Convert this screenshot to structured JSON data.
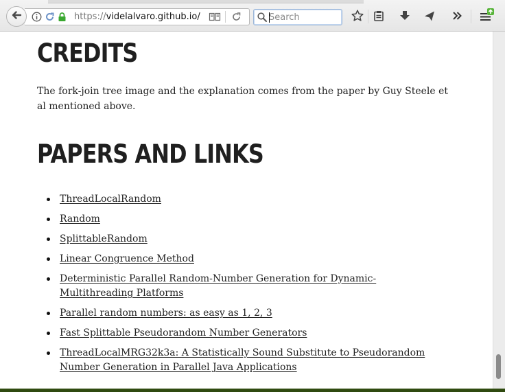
{
  "browser": {
    "url_scheme": "https://",
    "url_host": "videlalvaro.github.io/",
    "search_placeholder": "Search"
  },
  "page": {
    "credits_heading": "CREDITS",
    "credits_text": "The fork-join tree image and the explanation comes from the paper by Guy Steele et al mentioned above.",
    "papers_heading": "PAPERS AND LINKS",
    "links": [
      "ThreadLocalRandom",
      "Random",
      "SplittableRandom",
      "Linear Congruence Method",
      "Deterministic Parallel Random-Number Generation for Dynamic-Multithreading Platforms",
      "Parallel random numbers: as easy as 1, 2, 3",
      "Fast Splittable Pseudorandom Number Generators",
      "ThreadLocalMRG32k3a: A Statistically Sound Substitute to Pseudorandom Number Generation in Parallel Java Applications"
    ]
  },
  "icons": {
    "back": "back-arrow-icon",
    "info": "info-icon",
    "lock": "lock-icon",
    "reader": "reader-view-icon",
    "reload": "reload-icon",
    "search": "search-icon",
    "bookmark": "star-icon",
    "clipboard": "clipboard-icon",
    "download": "download-icon",
    "send": "send-icon",
    "overflow": "overflow-chevrons-icon",
    "menu": "hamburger-menu-icon"
  },
  "colors": {
    "lock_green": "#3aa830",
    "update_badge": "#58b43a"
  }
}
